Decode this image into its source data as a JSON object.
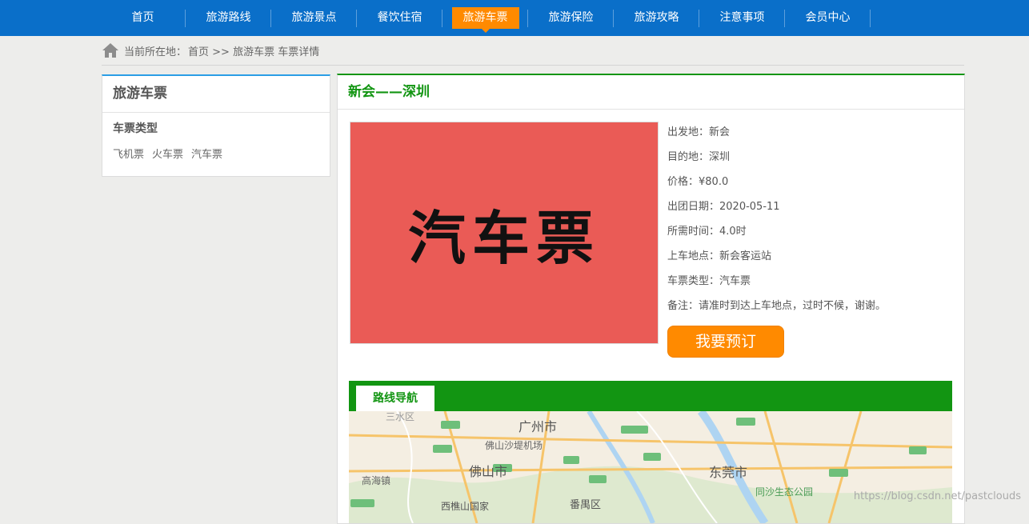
{
  "nav": {
    "items": [
      {
        "label": "首页"
      },
      {
        "label": "旅游路线"
      },
      {
        "label": "旅游景点"
      },
      {
        "label": "餐饮住宿"
      },
      {
        "label": "旅游车票",
        "active": true
      },
      {
        "label": "旅游保险"
      },
      {
        "label": "旅游攻略"
      },
      {
        "label": "注意事项"
      },
      {
        "label": "会员中心"
      }
    ]
  },
  "breadcrumb": {
    "label": "当前所在地：",
    "path": "首页 >> 旅游车票 车票详情"
  },
  "sidebar": {
    "title": "旅游车票",
    "subtitle": "车票类型",
    "links": [
      "飞机票",
      "火车票",
      "汽车票"
    ]
  },
  "ticket": {
    "title": "新会——深圳",
    "image_text": "汽车票",
    "details": [
      {
        "text": "出发地：新会"
      },
      {
        "text": "目的地：深圳"
      },
      {
        "text": "价格：¥80.0"
      },
      {
        "text": "出团日期：2020-05-11"
      },
      {
        "text": "所需时间：4.0时"
      },
      {
        "text": "上车地点：新会客运站"
      },
      {
        "text": "车票类型：汽车票"
      },
      {
        "text": "备注：请准时到达上车地点，过时不候，谢谢。"
      }
    ],
    "book_button": "我要预订"
  },
  "route": {
    "tab_label": "路线导航",
    "map_labels": {
      "guangzhou": "广州市",
      "foshan": "佛山市",
      "dongguan": "东莞市",
      "panyu": "番禺区",
      "airport": "佛山沙堤机场",
      "gaohai": "高海镇",
      "shatong": "同沙生态公园",
      "xiqiao": "西樵山国家",
      "sanshui": "三水区"
    }
  },
  "watermark": "https://blog.csdn.net/pastclouds",
  "colors": {
    "nav_bg": "#0a6fc9",
    "active_tab": "#ff8a00",
    "green": "#129512",
    "sidebar_accent": "#2a9ee6",
    "ticket_bg": "#ea5b56"
  }
}
